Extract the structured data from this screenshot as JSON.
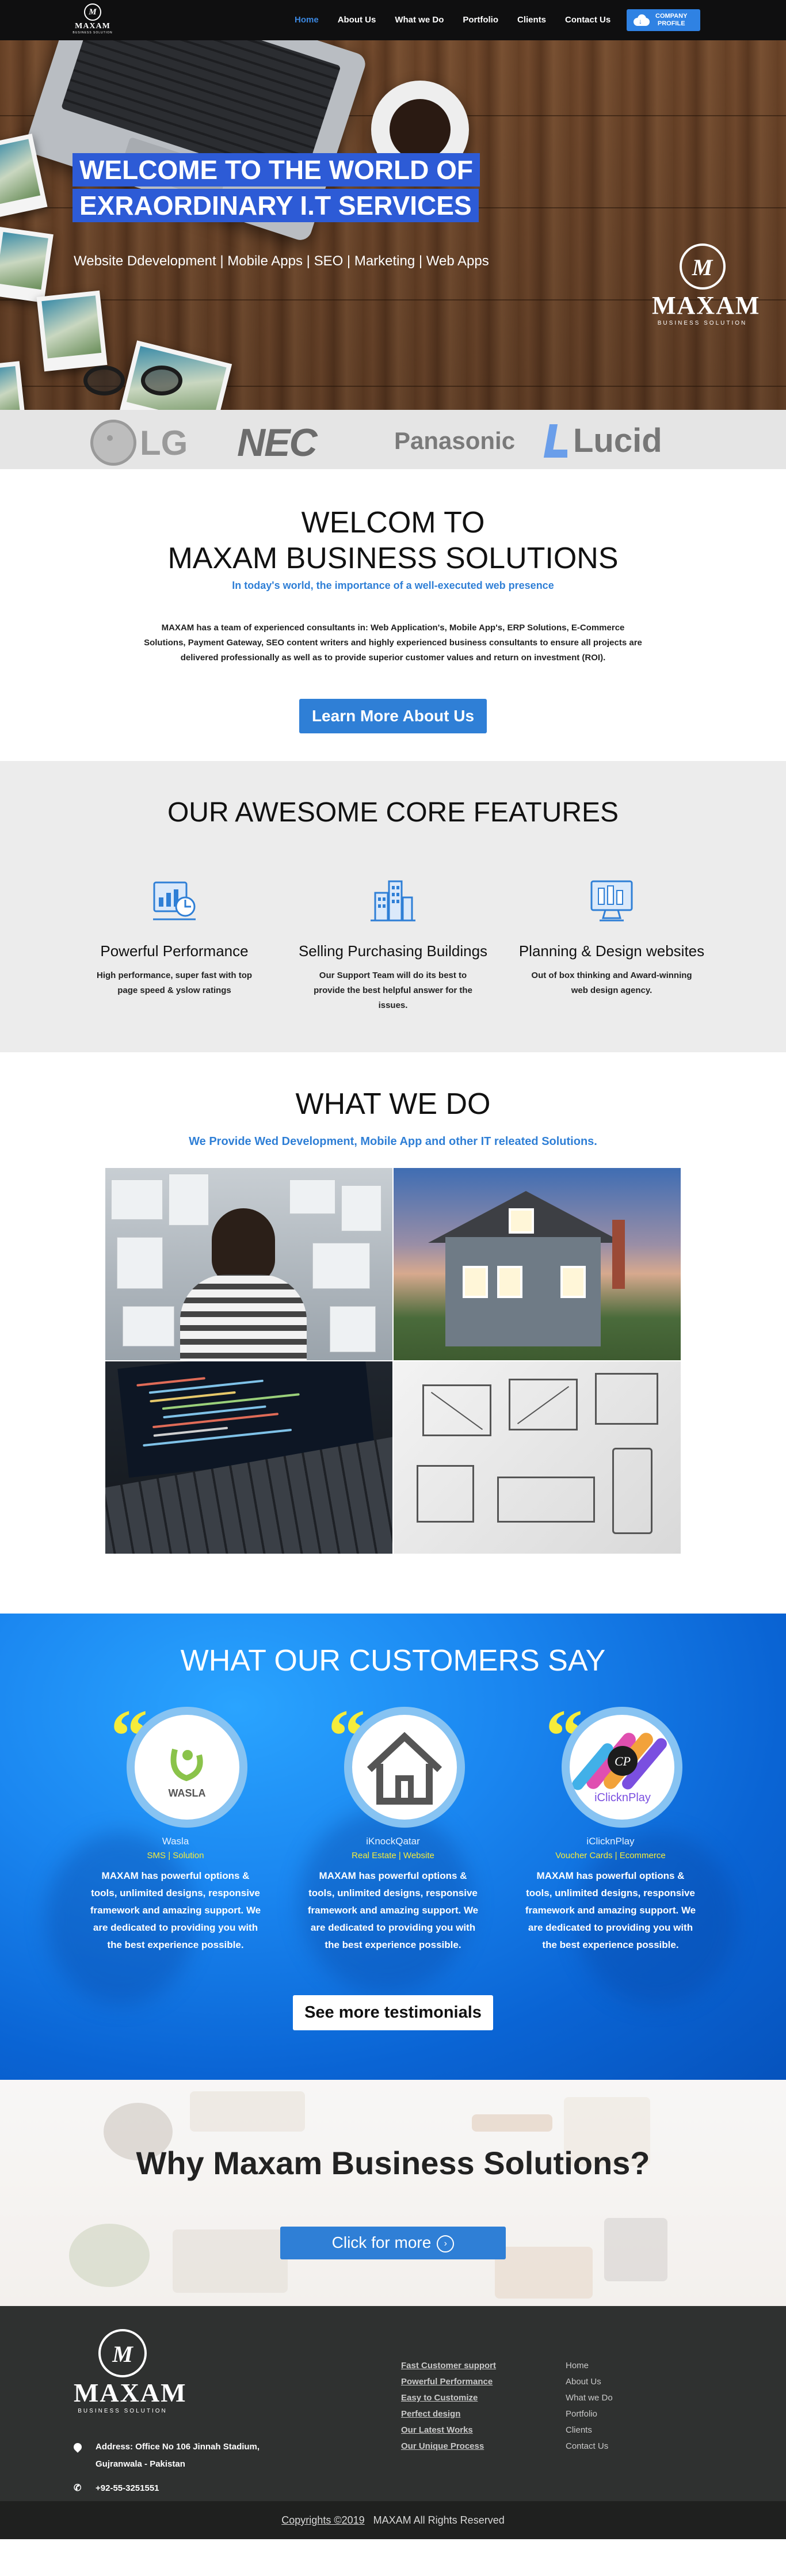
{
  "header": {
    "logo": {
      "brand": "MAXAM",
      "tagline": "BUSINESS SOLUTION"
    },
    "nav": [
      "Home",
      "About Us",
      "What we Do",
      "Portfolio",
      "Clients",
      "Contact Us"
    ],
    "active_nav": "Home",
    "profile_button": {
      "line1": "COMPANY",
      "line2": "PROFILE",
      "icon": "cloud-download-icon"
    }
  },
  "hero": {
    "title_line1": "WELCOME TO THE WORLD OF",
    "title_line2": "EXRAORDINARY I.T SERVICES",
    "subtitle": "Website Ddevelopment | Mobile Apps | SEO | Marketing | Web Apps",
    "logo": {
      "brand": "MAXAM",
      "tagline": "BUSINESS SOLUTION"
    }
  },
  "clients": {
    "logos": [
      "LG",
      "NEC",
      "Panasonic",
      "Lucid"
    ]
  },
  "welcome": {
    "title_line1": "WELCOM TO",
    "title_line2": "MAXAM BUSINESS SOLUTIONS",
    "tagline": "In today's world, the importance of a well-executed web presence",
    "body": "MAXAM has a team of experienced consultants in: Web Application's, Mobile App's, ERP Solutions, E-Commerce Solutions, Payment Gateway, SEO content writers and highly experienced business consultants to ensure all projects are delivered professionally as well as to provide superior customer values and return on investment (ROI).",
    "button": "Learn More About Us"
  },
  "features": {
    "title": "OUR AWESOME CORE FEATURES",
    "items": [
      {
        "icon": "performance-report-icon",
        "title": "Powerful Performance",
        "desc": "High performance, super fast with top page speed & yslow ratings"
      },
      {
        "icon": "buildings-icon",
        "title": "Selling Purchasing Buildings",
        "desc": "Our Support Team will do its best to provide the best helpful answer for the issues."
      },
      {
        "icon": "design-monitor-icon",
        "title": "Planning & Design websites",
        "desc": "Out of box thinking and Award-winning web design agency."
      }
    ]
  },
  "what_we_do": {
    "title": "WHAT WE DO",
    "tagline": "We Provide Wed Development, Mobile App and other IT releated Solutions."
  },
  "testimonials": {
    "title": "WHAT OUR CUSTOMERS SAY",
    "items": [
      {
        "name": "Wasla",
        "role": "SMS | Solution",
        "logo_text": "WASLA",
        "desc": "MAXAM has powerful options & tools, unlimited designs, responsive framework and amazing support. We are dedicated to providing you with the best experience possible."
      },
      {
        "name": "iKnockQatar",
        "role": "Real Estate | Website",
        "logo_text": "",
        "desc": "MAXAM has powerful options & tools, unlimited designs, responsive framework and amazing support. We are dedicated to providing you with the best experience possible."
      },
      {
        "name": "iClicknPlay",
        "role": "Voucher Cards | Ecommerce",
        "logo_text": "iClicknPlay",
        "desc": "MAXAM has powerful options & tools, unlimited designs, responsive framework and amazing support. We are dedicated to providing you with the best experience possible."
      }
    ],
    "button": "See more testimonials"
  },
  "why": {
    "title": "Why Maxam Business Solutions?",
    "button": "Click for more"
  },
  "footer": {
    "logo": {
      "brand": "MAXAM",
      "tagline": "BUSINESS SOLUTION"
    },
    "address_line1": "Address: Office No 106 Jinnah Stadium,",
    "address_line2": "Gujranwala - Pakistan",
    "phone": "+92-55-3251551",
    "links_col1": [
      "Fast Customer support",
      "Powerful Performance",
      "Easy to Customize",
      "Perfect design",
      "Our Latest Works",
      "Our Unique Process"
    ],
    "links_col2": [
      "Home",
      "About Us",
      "What we Do",
      "Portfolio",
      "Clients",
      "Contact Us"
    ],
    "copyright_link": "Copyrights ©2019",
    "copyright_text": "MAXAM All Rights Reserved"
  },
  "colors": {
    "accent_blue": "#2f7fd6",
    "nav_active": "#3b87e0",
    "hero_highlight": "#2d5bd6",
    "testimonial_bg": "#1a86f0",
    "quote_yellow": "#f5ec3a",
    "footer_bg": "#2f3130"
  }
}
